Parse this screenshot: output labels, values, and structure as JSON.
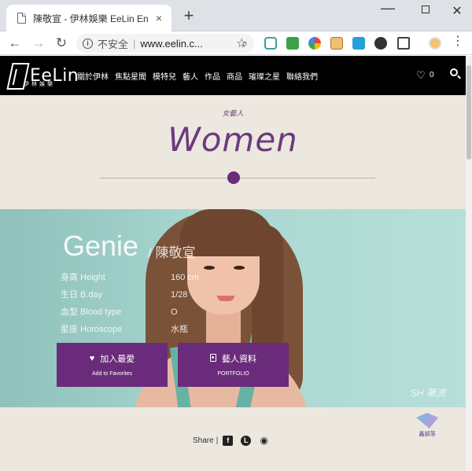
{
  "browser": {
    "tab_title": "陳敬宣 - 伊林娛樂 EeLin Entertai",
    "tab_close": "×",
    "new_tab": "+",
    "win_min": "—",
    "win_close": "✕",
    "nav_back": "←",
    "nav_forward": "→",
    "nav_reload": "↻",
    "security_label": "不安全",
    "url": "www.eelin.c...",
    "star": "☆",
    "menu_dots": "⋮",
    "zoom": "⌕",
    "info_icon": "i"
  },
  "site": {
    "logo_text": "EeLin",
    "logo_sub": "伊林娛樂",
    "menu": [
      "關於伊林",
      "焦點星聞",
      "模特兒",
      "藝人",
      "作品",
      "商品",
      "璀璨之星",
      "聯絡我們"
    ],
    "heart": "♡",
    "fav_count": "0"
  },
  "category": {
    "subtitle": "女藝人",
    "title": "Women"
  },
  "profile": {
    "name_en": "Genie",
    "name_cn": "/ 陳敬宣",
    "rows": [
      {
        "label": "身高  Height",
        "value": "160 cm"
      },
      {
        "label": "生日  B.day",
        "value": "1/28"
      },
      {
        "label": "血型  Blood type",
        "value": "O"
      },
      {
        "label": "星座  Horoscope",
        "value": "水瓶"
      }
    ]
  },
  "buttons": {
    "fav_main": "加入最愛",
    "fav_sub": "Add to Favorites",
    "fav_icon": "♥",
    "portfolio_main": "藝人資料",
    "portfolio_sub": "PORTFOLIO"
  },
  "watermark": "SH 華流",
  "share": {
    "label": "Share",
    "sep": "|",
    "fb": "f",
    "line": "L",
    "weibo": "◉"
  },
  "badge_text": "鑫部落",
  "colors": {
    "accent": "#6a2c7a",
    "page_bg": "#ece7df",
    "hero_bg": "#a8d6d0",
    "nav_bg": "#000000"
  }
}
